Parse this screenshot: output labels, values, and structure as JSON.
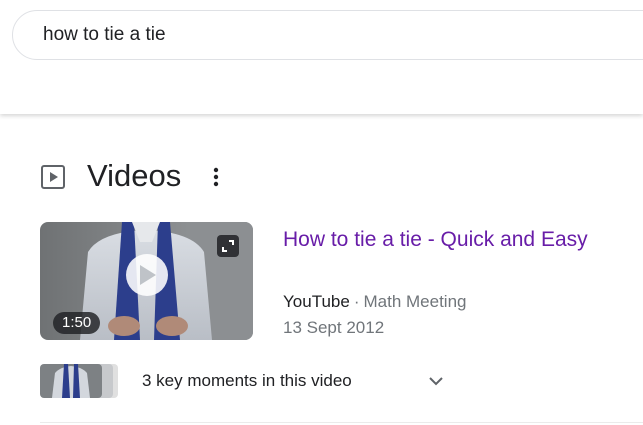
{
  "search": {
    "query": "how to tie a tie"
  },
  "videos_section": {
    "title": "Videos",
    "header_icon": "play-square-icon",
    "menu_icon": "more-vert-icon"
  },
  "video_result": {
    "title": "How to tie a tie - Quick and Easy",
    "source": "YouTube",
    "separator": "·",
    "channel": "Math Meeting",
    "date": "13 Sept 2012",
    "duration": "1:50",
    "thumbnail_icons": [
      "play-icon",
      "expand-icon"
    ]
  },
  "key_moments": {
    "label": "3 key moments in this video",
    "icon": "chevron-down-icon"
  },
  "colors": {
    "visited_link": "#681da8",
    "text_primary": "#202124",
    "text_secondary": "#70757a",
    "border": "#dfe1e5"
  }
}
